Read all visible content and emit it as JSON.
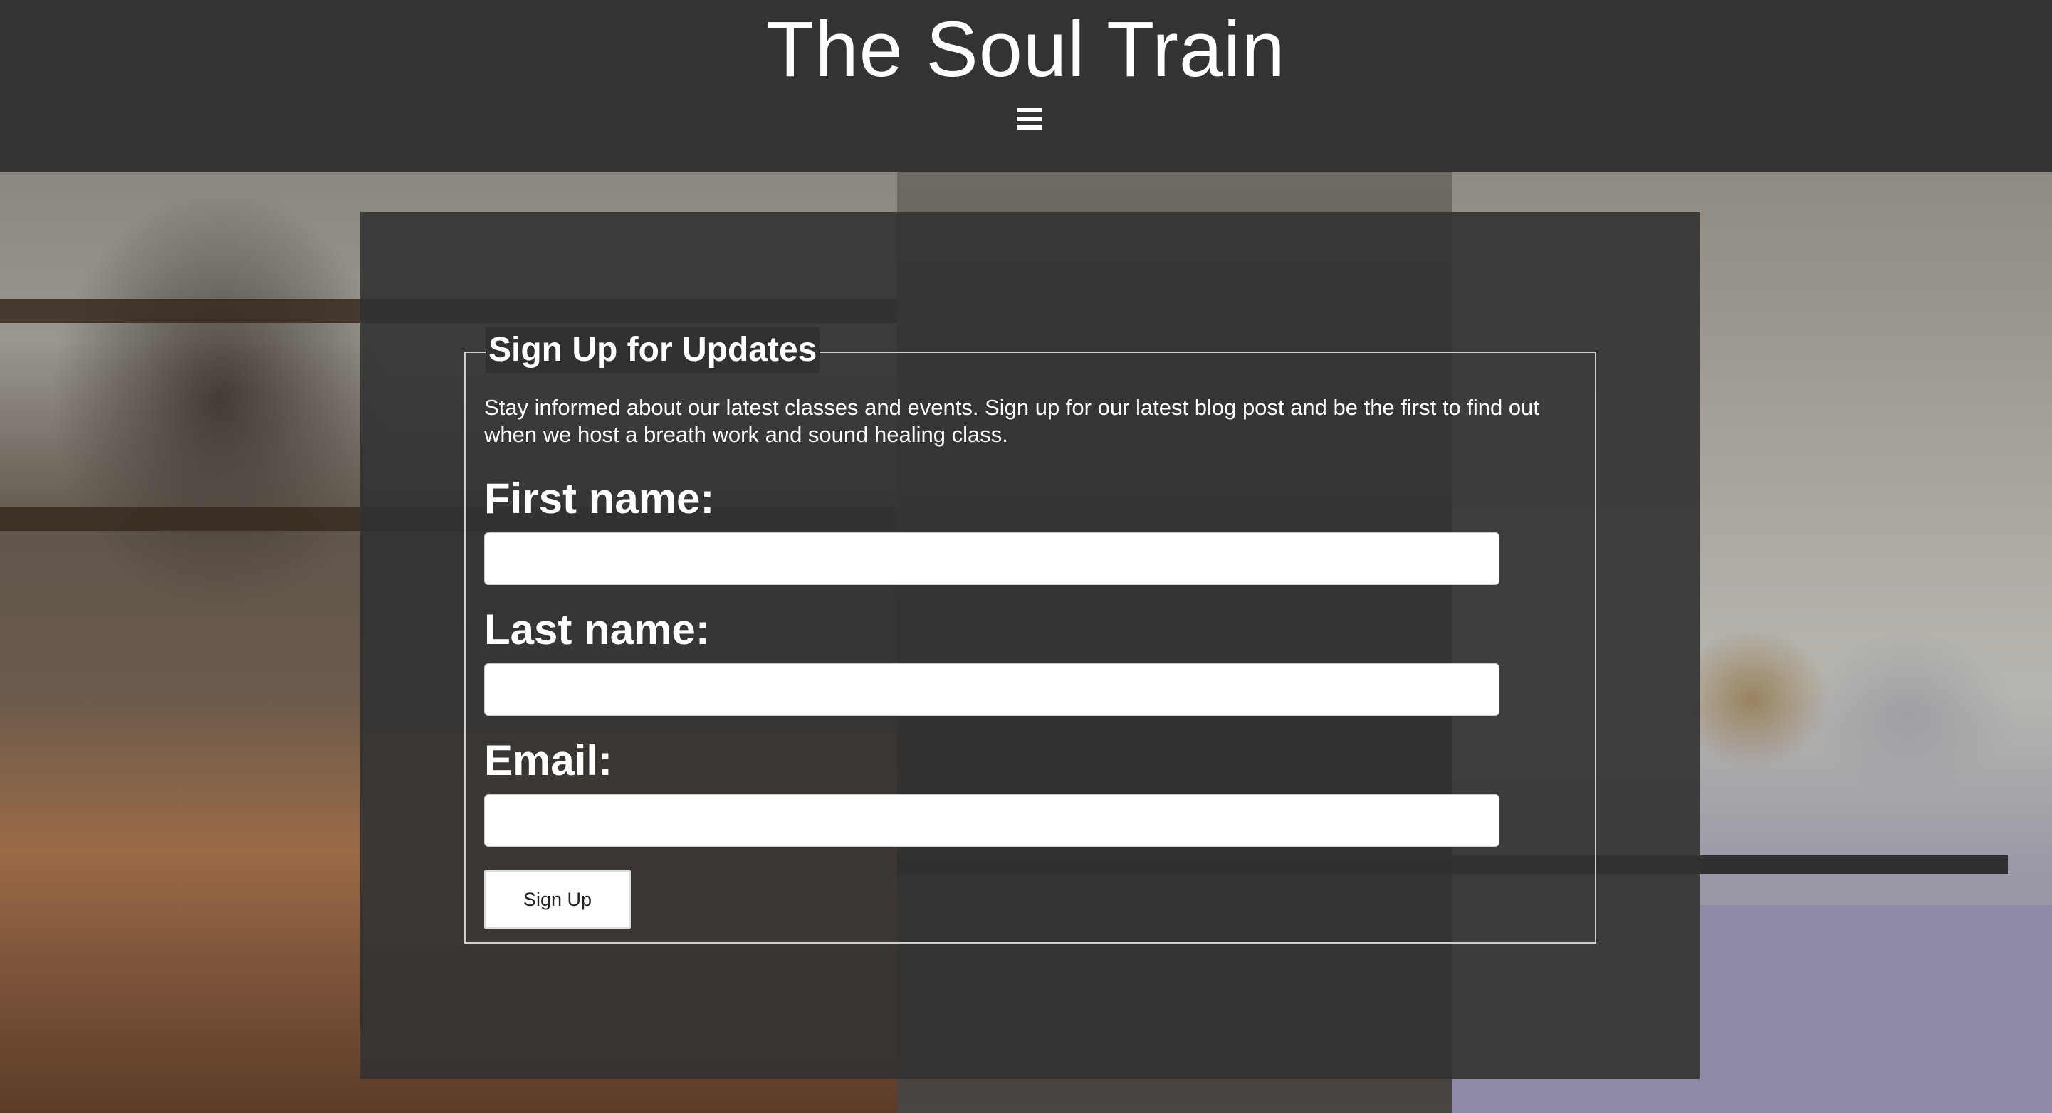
{
  "header": {
    "title": "The Soul Train",
    "menu_icon": "hamburger-menu-icon"
  },
  "signup": {
    "legend": "Sign Up for Updates",
    "description": "Stay informed about our latest classes and events. Sign up for our latest blog post and be the first to find out when we host a breath work and sound healing class.",
    "fields": [
      {
        "label": "First name:",
        "value": "",
        "placeholder": ""
      },
      {
        "label": "Last name:",
        "value": "",
        "placeholder": ""
      },
      {
        "label": "Email:",
        "value": "",
        "placeholder": ""
      }
    ],
    "submit_label": "Sign Up"
  },
  "colors": {
    "header_bg": "#333333",
    "panel_bg": "#323232",
    "text": "#ffffff"
  }
}
